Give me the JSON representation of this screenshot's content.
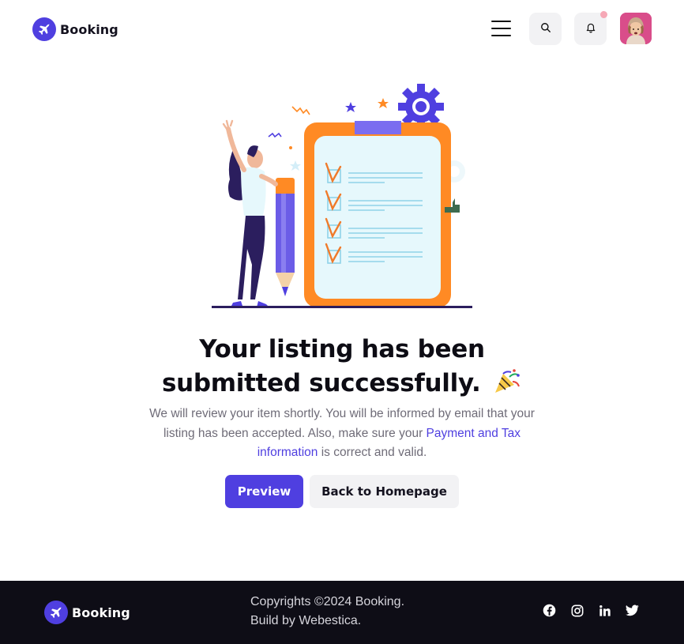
{
  "brand": {
    "name": "Booking",
    "logo_icon": "airplane-icon",
    "color": "#4f3fe0"
  },
  "header": {
    "menu_icon": "hamburger-icon",
    "search_icon": "search-icon",
    "bell_icon": "bell-icon",
    "avatar": "user-avatar"
  },
  "main": {
    "title_line1": "Your listing has been",
    "title_line2": "submitted successfully.",
    "title_emoji_icon": "party-popper-icon",
    "desc_part1": "We will review your item shortly. You will be informed by email that your listing has been accepted. Also, make sure your ",
    "desc_link": "Payment and Tax information",
    "desc_part2": " is correct and valid.",
    "preview_label": "Preview",
    "home_label": "Back to Homepage"
  },
  "footer": {
    "brand_name": "Booking",
    "copyright": "Copyrights ©2024 Booking.",
    "build_by": "Build by Webestica.",
    "social_icons": [
      "facebook-icon",
      "instagram-icon",
      "linkedin-icon",
      "twitter-icon"
    ]
  },
  "colors": {
    "accent": "#4f3fe0",
    "secondary_button": "#f2f2f4",
    "footer_bg": "#0e0d16",
    "clipboard_orange": "#ff8a24",
    "notification_dot": "#f6a8b6"
  }
}
